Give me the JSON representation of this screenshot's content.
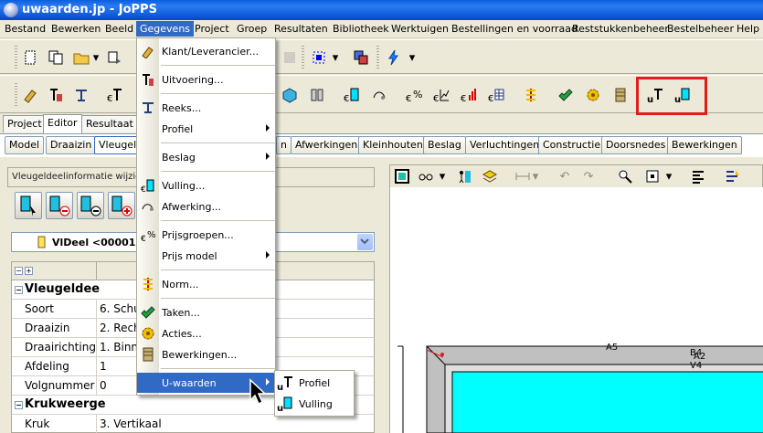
{
  "window": {
    "title": "uwaarden.jp - JoPPS"
  },
  "menubar": [
    "Bestand",
    "Bewerken",
    "Beeld",
    "Gegevens",
    "Project",
    "Groep",
    "Resultaten",
    "Bibliotheek",
    "Werktuigen",
    "Bestellingen en voorraad",
    "Reststukkenbeheer",
    "Bestelbeheer",
    "Help"
  ],
  "main_tabs": [
    "Project",
    "Editor",
    "Resultaat"
  ],
  "sub_tabs": [
    "Model",
    "Draaizin",
    "Vleugel",
    "n",
    "Afwerkingen",
    "Kleinhouten",
    "Beslag",
    "Verluchtingen",
    "Constructie",
    "Doorsnedes",
    "Bewerkingen"
  ],
  "panel": {
    "label": "Vleugeldeelinformatie wijzige",
    "combo_value": "VlDeel <00001>"
  },
  "grid": {
    "section1": "Vleugeldee",
    "rows1": [
      {
        "k": "Soort",
        "v": "6. Schu"
      },
      {
        "k": "Draaizin",
        "v": "2. Rech"
      },
      {
        "k": "Draairichting",
        "v": "1. Binn"
      },
      {
        "k": "Afdeling",
        "v": "1"
      },
      {
        "k": "Volgnummer",
        "v": "0"
      }
    ],
    "section2": "Krukweerge",
    "rows2": [
      {
        "k": "Kruk",
        "v": "3. Vertikaal"
      }
    ]
  },
  "dropdown": {
    "items": [
      {
        "label": "Klant/Leverancier...",
        "icon": "customer-icon"
      },
      {
        "label": "Uitvoering...",
        "icon": "execution-icon"
      },
      {
        "label": "Reeks...",
        "icon": "series-icon"
      },
      {
        "label": "Profiel",
        "submenu": true
      },
      {
        "label": "Beslag",
        "submenu": true
      },
      {
        "label": "Vulling...",
        "icon": "filling-icon"
      },
      {
        "label": "Afwerking...",
        "icon": "finish-icon"
      },
      {
        "label": "Prijsgroepen...",
        "icon": "price-groups-icon"
      },
      {
        "label": "Prijs model",
        "submenu": true
      },
      {
        "label": "Norm...",
        "icon": "norm-icon"
      },
      {
        "label": "Taken...",
        "icon": "tasks-icon"
      },
      {
        "label": "Acties...",
        "icon": "actions-icon"
      },
      {
        "label": "Bewerkingen...",
        "icon": "operations-icon"
      },
      {
        "label": "U-waarden",
        "submenu": true,
        "highlighted": true
      }
    ]
  },
  "submenu": {
    "items": [
      {
        "label": "Profiel",
        "icon": "u-profile-icon"
      },
      {
        "label": "Vulling",
        "icon": "u-filling-icon"
      }
    ]
  },
  "drawing": {
    "labels": [
      "A5",
      "B4",
      "A2",
      "V4"
    ]
  },
  "colors": {
    "accent": "#316ac5",
    "fill": "#00ffff",
    "highlight": "#e01c1c"
  }
}
